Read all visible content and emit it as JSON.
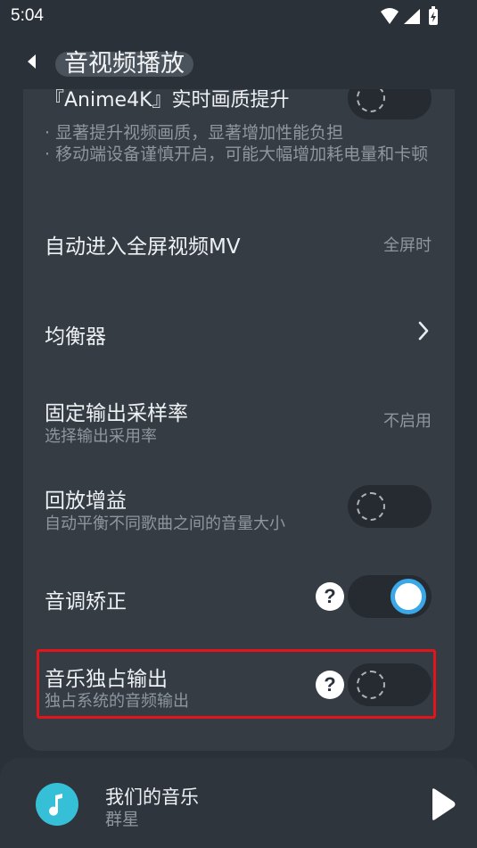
{
  "status_bar": {
    "time": "5:04"
  },
  "header": {
    "title": "音视频播放"
  },
  "settings": {
    "anime4k": {
      "title": "『Anime4K』实时画质提升",
      "desc_1": "· 显著提升视频画质，显著增加性能负担",
      "desc_2": "· 移动端设备谨慎开启，可能大幅增加耗电量和卡顿",
      "enabled": false
    },
    "fullscreen_mv": {
      "title": "自动进入全屏视频MV",
      "value": "全屏时"
    },
    "equalizer": {
      "title": "均衡器"
    },
    "sample_rate": {
      "title": "固定输出采样率",
      "subtitle": "选择输出采用率",
      "value": "不启用"
    },
    "replay_gain": {
      "title": "回放增益",
      "subtitle": "自动平衡不同歌曲之间的音量大小",
      "enabled": false
    },
    "pitch_correction": {
      "title": "音调矫正",
      "help": "?",
      "enabled": true
    },
    "exclusive_output": {
      "title": "音乐独占输出",
      "subtitle": "独占系统的音频输出",
      "help": "?",
      "enabled": false
    }
  },
  "now_playing": {
    "title": "我们的音乐",
    "artist": "群星"
  },
  "colors": {
    "background": "#2b3139",
    "card": "#353c44",
    "accent": "#3aa7e6",
    "highlight": "#e3151b",
    "album_art": "#36c0d8"
  }
}
